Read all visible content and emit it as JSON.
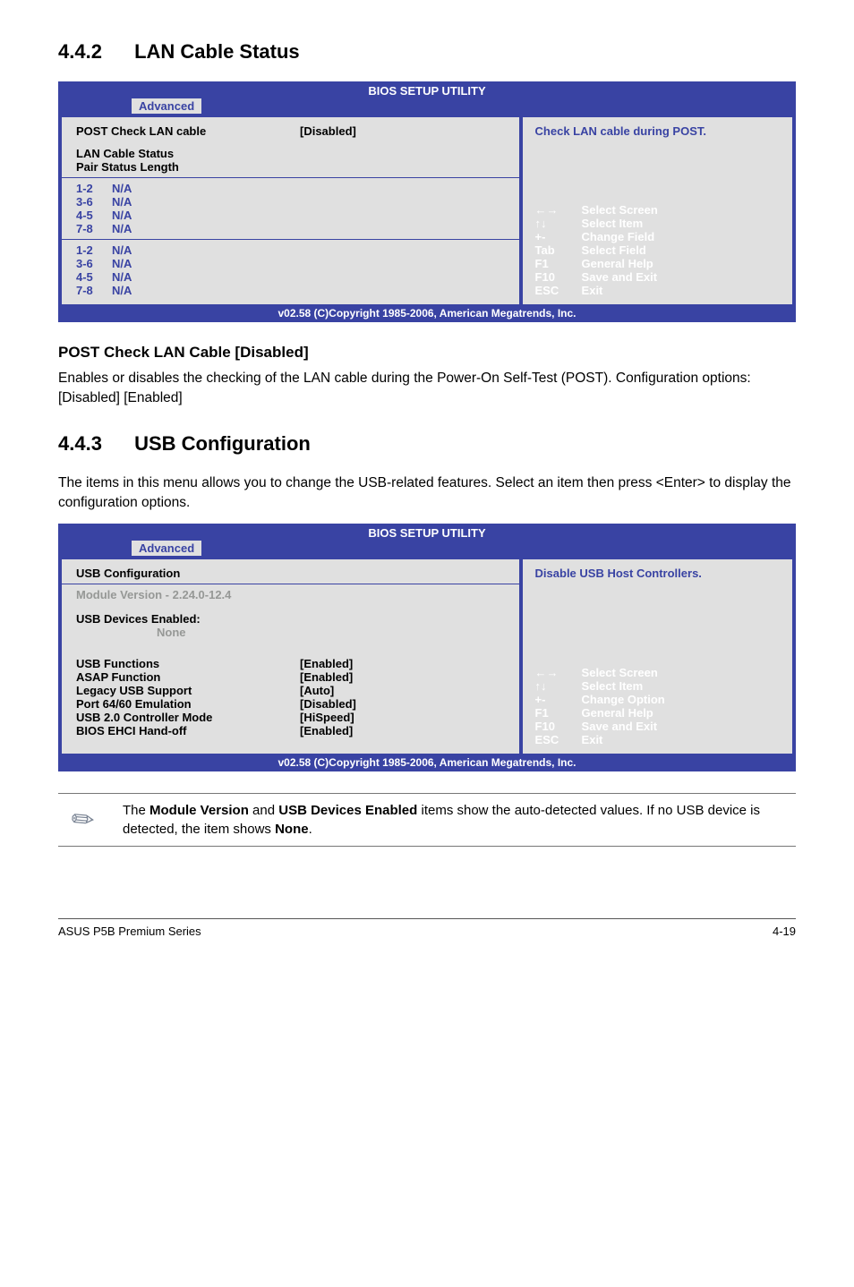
{
  "section442": {
    "title_num": "4.4.2",
    "title": "LAN Cable Status"
  },
  "bios1": {
    "title": "BIOS SETUP UTILITY",
    "tab": "Advanced",
    "left": {
      "post_label": "POST Check LAN cable",
      "post_value": "[Disabled]",
      "lan_hdr": "LAN Cable Status",
      "pair_hdr": "Pair  Status  Length",
      "pairsA": [
        {
          "p": "1-2",
          "s": "N/A"
        },
        {
          "p": "3-6",
          "s": "N/A"
        },
        {
          "p": "4-5",
          "s": "N/A"
        },
        {
          "p": "7-8",
          "s": "N/A"
        }
      ],
      "pairsB": [
        {
          "p": "1-2",
          "s": "N/A"
        },
        {
          "p": "3-6",
          "s": "N/A"
        },
        {
          "p": "4-5",
          "s": "N/A"
        },
        {
          "p": "7-8",
          "s": "N/A"
        }
      ]
    },
    "right": {
      "help_text": "Check LAN cable during POST.",
      "keys": [
        {
          "k": "←→",
          "v": "Select Screen"
        },
        {
          "k": "↑↓",
          "v": "Select Item"
        },
        {
          "k": "+-",
          "v": "Change Field"
        },
        {
          "k": "Tab",
          "v": "Select Field"
        },
        {
          "k": "F1",
          "v": "General Help"
        },
        {
          "k": "F10",
          "v": "Save and Exit"
        },
        {
          "k": "ESC",
          "v": "Exit"
        }
      ]
    },
    "footer": "v02.58 (C)Copyright 1985-2006, American Megatrends, Inc."
  },
  "postcheck": {
    "head": "POST Check LAN Cable [Disabled]",
    "body": "Enables or disables the checking of the LAN cable during the Power-On Self-Test (POST). Configuration options: [Disabled] [Enabled]"
  },
  "section443": {
    "title_num": "4.4.3",
    "title": "USB Configuration",
    "intro": "The items in this menu allows you to change the USB-related features. Select an item then press <Enter> to display the configuration options."
  },
  "bios2": {
    "title": "BIOS SETUP UTILITY",
    "tab": "Advanced",
    "left": {
      "hdr": "USB Configuration",
      "module": "Module Version - 2.24.0-12.4",
      "dev_hdr": "USB Devices Enabled:",
      "dev_value": "None",
      "items": [
        {
          "l": "USB Functions",
          "v": "[Enabled]"
        },
        {
          "l": "ASAP Function",
          "v": "[Enabled]"
        },
        {
          "l": "Legacy USB Support",
          "v": "[Auto]"
        },
        {
          "l": "Port 64/60 Emulation",
          "v": "[Disabled]"
        },
        {
          "l": "USB 2.0 Controller Mode",
          "v": "[HiSpeed]"
        },
        {
          "l": "BIOS EHCI Hand-off",
          "v": "[Enabled]"
        }
      ]
    },
    "right": {
      "help_text": "Disable USB Host Controllers.",
      "keys": [
        {
          "k": "←→",
          "v": "Select Screen"
        },
        {
          "k": "↑↓",
          "v": "Select Item"
        },
        {
          "k": "+-",
          "v": "Change Option"
        },
        {
          "k": "F1",
          "v": "General Help"
        },
        {
          "k": "F10",
          "v": "Save and Exit"
        },
        {
          "k": "ESC",
          "v": "Exit"
        }
      ]
    },
    "footer": "v02.58 (C)Copyright 1985-2006, American Megatrends, Inc."
  },
  "note": {
    "p1": "The ",
    "b1": "Module Version",
    "p2": " and ",
    "b2": "USB Devices Enabled",
    "p3": " items show the auto-detected values. If no USB device is detected, the item shows ",
    "b3": "None",
    "p4": "."
  },
  "footer": {
    "left": "ASUS P5B Premium Series",
    "right": "4-19"
  }
}
